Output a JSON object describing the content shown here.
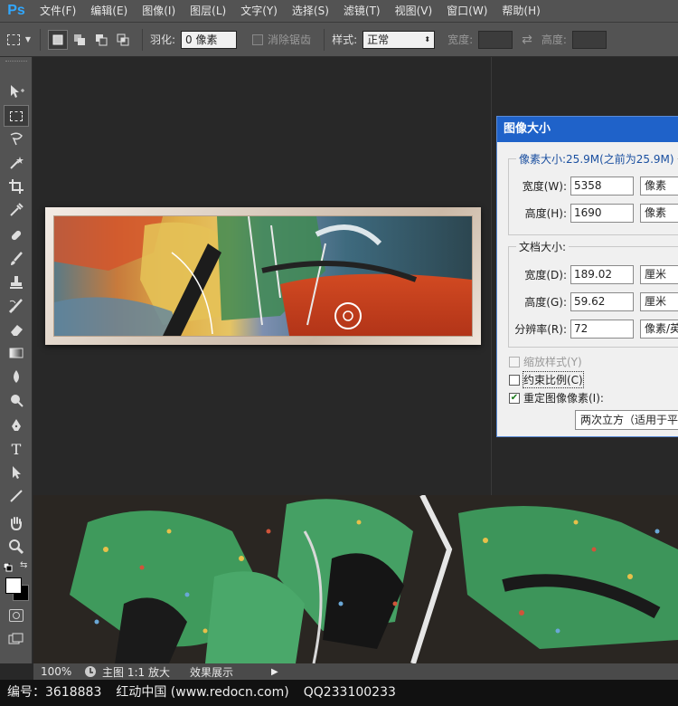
{
  "app": {
    "logo": "Ps"
  },
  "menu": [
    {
      "label": "文件(F)"
    },
    {
      "label": "编辑(E)"
    },
    {
      "label": "图像(I)"
    },
    {
      "label": "图层(L)"
    },
    {
      "label": "文字(Y)"
    },
    {
      "label": "选择(S)"
    },
    {
      "label": "滤镜(T)"
    },
    {
      "label": "视图(V)"
    },
    {
      "label": "窗口(W)"
    },
    {
      "label": "帮助(H)"
    }
  ],
  "options": {
    "feather_label": "羽化:",
    "feather_value": "0 像素",
    "antialias_label": "消除锯齿",
    "style_label": "样式:",
    "style_value": "正常",
    "width_label": "宽度:",
    "height_label": "高度:"
  },
  "dialog": {
    "title": "图像大小",
    "pixel_legend": "像素大小:25.9M(之前为25.9M)",
    "px_width_label": "宽度(W):",
    "px_width_value": "5358",
    "px_width_unit": "像素",
    "px_height_label": "高度(H):",
    "px_height_value": "1690",
    "px_height_unit": "像素",
    "doc_legend": "文档大小:",
    "doc_width_label": "宽度(D):",
    "doc_width_value": "189.02",
    "doc_width_unit": "厘米",
    "doc_height_label": "高度(G):",
    "doc_height_value": "59.62",
    "doc_height_unit": "厘米",
    "resolution_label": "分辨率(R):",
    "resolution_value": "72",
    "resolution_unit": "像素/英寸",
    "scale_styles_label": "缩放样式(Y)",
    "constrain_label": "约束比例(C)",
    "resample_label": "重定图像像素(I):",
    "resample_value": "两次立方（适用于平滑渐变）",
    "scale_styles_checked": false,
    "constrain_checked": false,
    "resample_checked": true
  },
  "status": {
    "zoom": "100%",
    "text1": "主图 1:1 放大",
    "text2": "效果展示"
  },
  "watermark": {
    "id_text": "编号：3618883",
    "site_text": "红动中国 (www.redocn.com)",
    "qq_text": "QQ233100233"
  },
  "colors": {
    "accent": "#31a8ff",
    "dialog_title": "#1f62c9",
    "foreground": "#ffffff",
    "background": "#000000"
  },
  "tools": [
    "move-icon",
    "marquee-icon",
    "lasso-icon",
    "magic-wand-icon",
    "crop-icon",
    "eyedropper-icon",
    "healing-brush-icon",
    "brush-icon",
    "clone-stamp-icon",
    "history-brush-icon",
    "eraser-icon",
    "gradient-icon",
    "blur-icon",
    "dodge-icon",
    "pen-icon",
    "type-icon",
    "path-select-icon",
    "line-icon",
    "hand-icon",
    "zoom-icon"
  ]
}
